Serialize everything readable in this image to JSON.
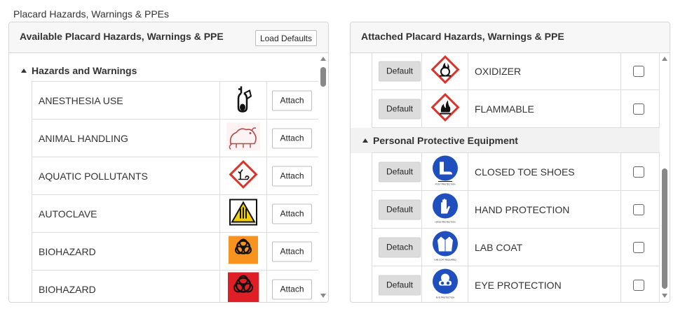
{
  "page": {
    "title": "Placard Hazards, Warnings & PPEs"
  },
  "available": {
    "title": "Available Placard Hazards, Warnings & PPE",
    "load_defaults_label": "Load Defaults",
    "group": {
      "label": "Hazards and Warnings"
    },
    "items": [
      {
        "name": "ANESTHESIA USE",
        "icon": "anesthesia-icon",
        "button": "Attach"
      },
      {
        "name": "ANIMAL HANDLING",
        "icon": "rat-icon",
        "button": "Attach"
      },
      {
        "name": "AQUATIC POLLUTANTS",
        "icon": "environment-hazard-icon",
        "button": "Attach"
      },
      {
        "name": "AUTOCLAVE",
        "icon": "autoclave-warning-icon",
        "button": "Attach"
      },
      {
        "name": "BIOHAZARD",
        "icon": "biohazard-orange-icon",
        "icon_label": "BIOHAZARD",
        "button": "Attach"
      },
      {
        "name": "BIOHAZARD",
        "icon": "biohazard-red-icon",
        "icon_label": "BIOHAZARD",
        "button": "Attach"
      }
    ]
  },
  "attached": {
    "title": "Attached Placard Hazards, Warnings & PPE",
    "hazard_items": [
      {
        "name": "OXIDIZER",
        "icon": "oxidizer-icon",
        "button": "Default"
      },
      {
        "name": "FLAMMABLE",
        "icon": "flammable-icon",
        "button": "Default"
      }
    ],
    "ppe_group": {
      "label": "Personal Protective Equipment"
    },
    "ppe_items": [
      {
        "name": "CLOSED TOE SHOES",
        "icon": "boots-icon",
        "button": "Default"
      },
      {
        "name": "HAND PROTECTION",
        "icon": "gloves-icon",
        "button": "Default"
      },
      {
        "name": "LAB COAT",
        "icon": "lab-coat-icon",
        "button": "Detach"
      },
      {
        "name": "EYE PROTECTION",
        "icon": "goggles-icon",
        "button": "Default"
      }
    ]
  },
  "colors": {
    "ghs_red": "#d9342b",
    "ppe_blue": "#1f4fbf",
    "orange": "#f7931e",
    "panel_header_bg": "#f7f7f7"
  }
}
